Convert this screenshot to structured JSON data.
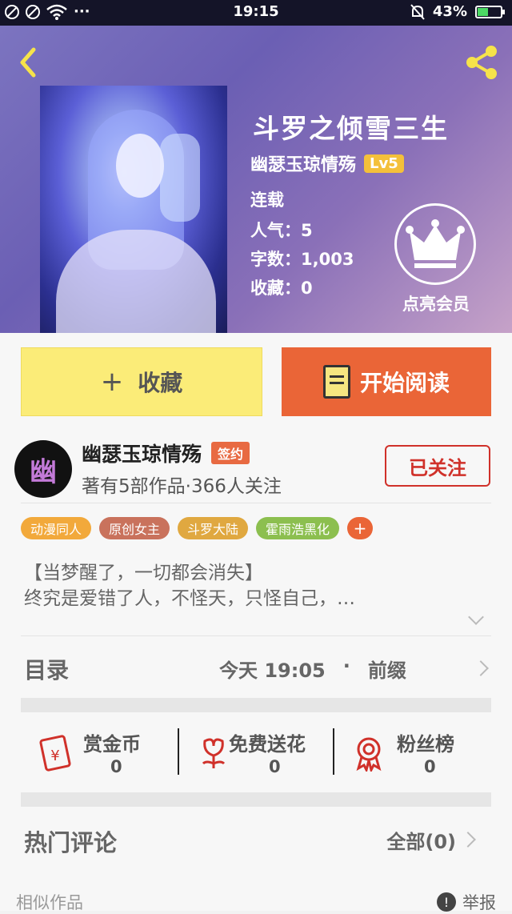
{
  "status_bar": {
    "time": "19:15",
    "battery": "43%",
    "battery_level": 0.43,
    "dots": "···"
  },
  "book": {
    "title": "斗罗之倾雪三生",
    "author": "幽瑟玉琼情殇",
    "level": "Lv5",
    "status": "连载",
    "popularity": "人气：5",
    "word_count": "字数：1,003",
    "favorites": "收藏：0"
  },
  "member_label": "点亮会员",
  "actions": {
    "favorite": "收藏",
    "favorite_plus": "+",
    "read": "开始阅读"
  },
  "author": {
    "avatar_char": "幽",
    "name": "幽瑟玉琼情殇",
    "badge": "签约",
    "summary": "著有5部作品·366人关注",
    "follow_button": "已关注"
  },
  "tags": [
    {
      "label": "动漫同人",
      "color": "#f2a93b"
    },
    {
      "label": "原创女主",
      "color": "#c9725c"
    },
    {
      "label": "斗罗大陆",
      "color": "#e0a840"
    },
    {
      "label": "霍雨浩黑化",
      "color": "#8cbf4f"
    }
  ],
  "tag_more": "+",
  "intro": {
    "line1": "【当梦醒了，一切都会消失】",
    "line2": "终究是爱错了人，不怪天，只怪自己，…"
  },
  "toc": {
    "label": "目录",
    "update_time": "今天 19:05",
    "dot": "·",
    "latest_chapter": "前缀"
  },
  "stats": [
    {
      "label": "赏金币",
      "value": "0"
    },
    {
      "label": "免费送花",
      "value": "0"
    },
    {
      "label": "粉丝榜",
      "value": "0"
    }
  ],
  "comments": {
    "title": "热门评论",
    "all": "全部(0)"
  },
  "similar": {
    "title": "相似作品",
    "report": "举报",
    "report_icon": "!"
  },
  "colors": {
    "accent": "#ea6537",
    "favorite_bg": "#fbec78",
    "follow": "#d0312a"
  }
}
